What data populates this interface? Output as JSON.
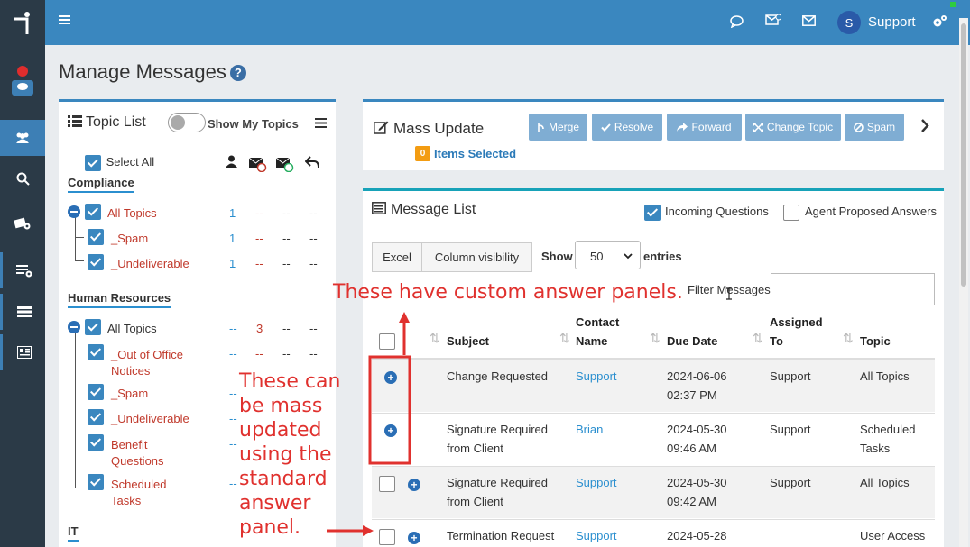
{
  "topbar": {
    "user_initial": "S",
    "user_name": "Support"
  },
  "page": {
    "title": "Manage Messages",
    "help": "?"
  },
  "topic_list": {
    "title": "Topic List",
    "toggle_label": "Show My Topics",
    "select_all": "Select All",
    "groups": [
      {
        "name": "Compliance",
        "rows": [
          {
            "label": "All Topics",
            "c1": "1",
            "c2": "--",
            "c3": "--",
            "c4": "--"
          },
          {
            "label": "_Spam",
            "c1": "1",
            "c2": "--",
            "c3": "--",
            "c4": "--"
          },
          {
            "label": "_Undeliverable",
            "c1": "1",
            "c2": "--",
            "c3": "--",
            "c4": "--"
          }
        ]
      },
      {
        "name": "Human Resources",
        "rows": [
          {
            "label": "All Topics",
            "c1": "--",
            "c2": "3",
            "c3": "--",
            "c4": "--"
          },
          {
            "label": "_Out of Office",
            "label2": "Notices",
            "c1": "--",
            "c2": "--",
            "c3": "--",
            "c4": "--"
          },
          {
            "label": "_Spam",
            "c1": "--"
          },
          {
            "label": "_Undeliverable",
            "c1": "--"
          },
          {
            "label": "Benefit",
            "label2": "Questions",
            "c1": "--"
          },
          {
            "label": "Scheduled",
            "label2": "Tasks",
            "c1": "--"
          }
        ]
      },
      {
        "name": "IT"
      }
    ]
  },
  "mass_update": {
    "title": "Mass Update",
    "count": "0",
    "items_selected": "Items Selected",
    "buttons": [
      "Merge",
      "Resolve",
      "Forward",
      "Change Topic",
      "Spam"
    ]
  },
  "message_list": {
    "title": "Message List",
    "incoming_label": "Incoming Questions",
    "agent_label": "Agent Proposed Answers",
    "excel": "Excel",
    "colvis": "Column visibility",
    "show": "Show",
    "entries_value": "50",
    "entries": "entries",
    "filter_label": "Filter Messages",
    "columns": {
      "subject": "Subject",
      "contact1": "Contact",
      "contact2": "Name",
      "due": "Due Date",
      "assigned1": "Assigned",
      "assigned2": "To",
      "topic": "Topic"
    },
    "rows": [
      {
        "subject1": "Change Requested",
        "subject2": "",
        "contact": "Support",
        "due1": "2024-06-06",
        "due2": "02:37 PM",
        "assigned": "Support",
        "topic1": "All Topics",
        "topic2": ""
      },
      {
        "subject1": "Signature Required",
        "subject2": "from Client",
        "contact": "Brian",
        "due1": "2024-05-30",
        "due2": "09:46 AM",
        "assigned": "Support",
        "topic1": "Scheduled",
        "topic2": "Tasks"
      },
      {
        "subject1": "Signature Required",
        "subject2": "from Client",
        "contact": "Support",
        "due1": "2024-05-30",
        "due2": "09:42 AM",
        "assigned": "Support",
        "topic1": "All Topics",
        "topic2": ""
      },
      {
        "subject1": "Termination Request",
        "subject2": "",
        "contact": "Support",
        "due1": "2024-05-28",
        "due2": "",
        "assigned": "",
        "topic1": "User Access",
        "topic2": ""
      }
    ]
  },
  "annotations": {
    "top": "These have custom answer panels.",
    "left": [
      "These can",
      "be mass",
      "updated",
      "using the",
      "standard",
      "answer",
      "panel."
    ]
  },
  "colors": {
    "topbar": "#3a87bf",
    "sidebar": "#2b3a47",
    "annotation": "#e0312e"
  }
}
